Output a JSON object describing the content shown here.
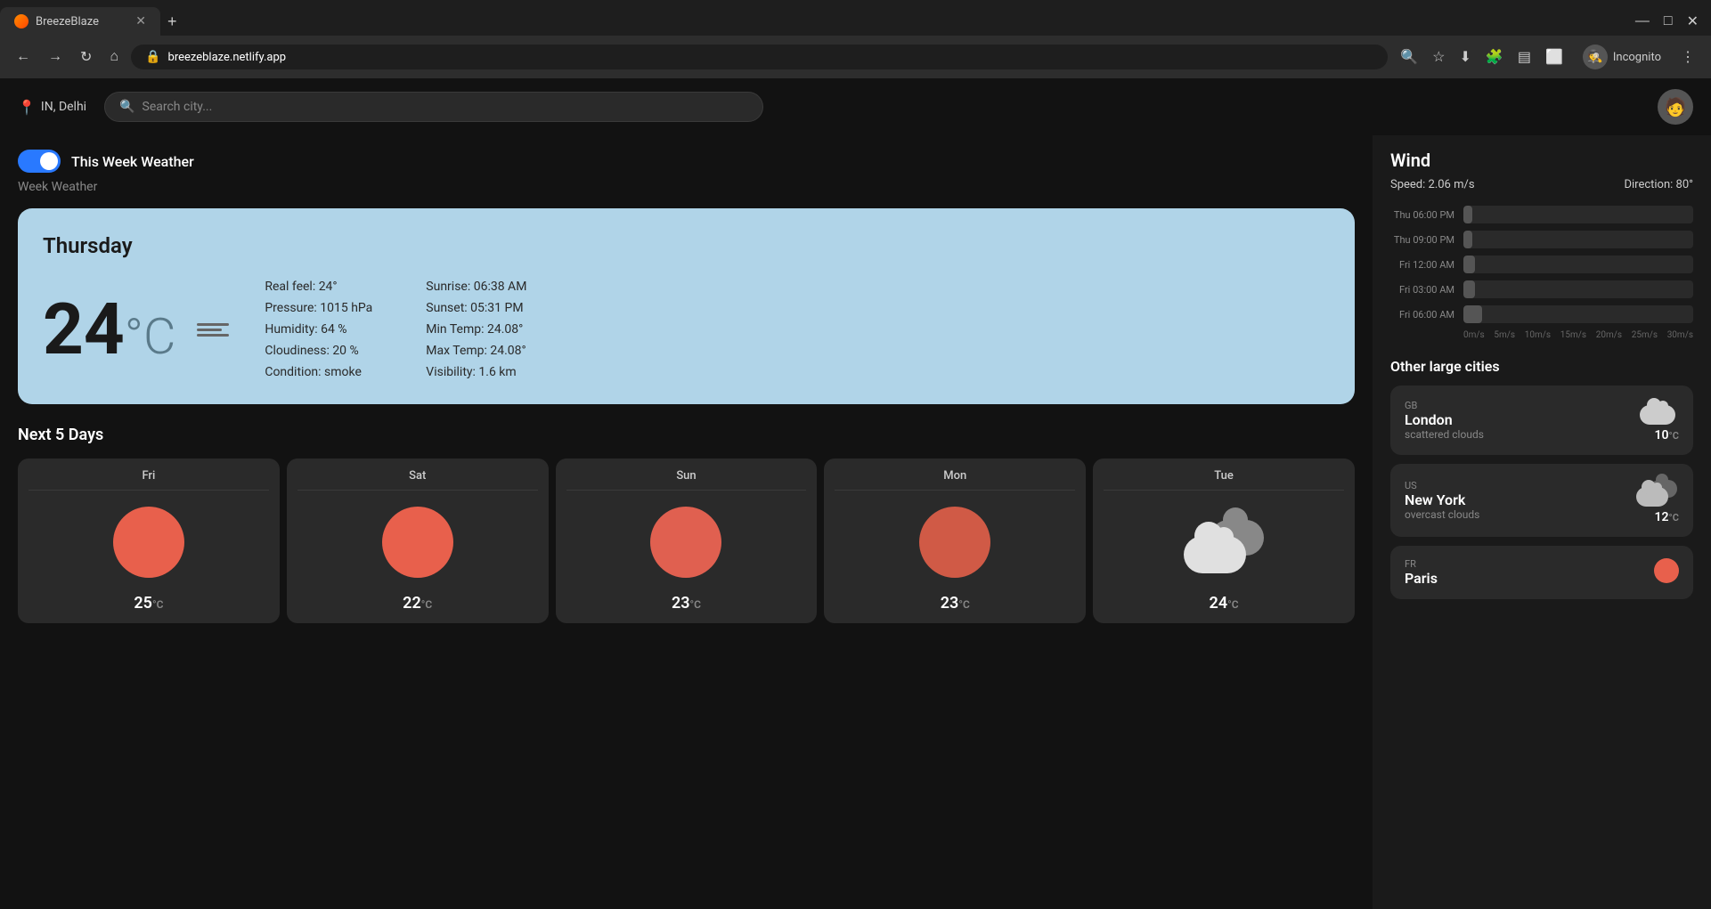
{
  "browser": {
    "tab_title": "BreezeBlaze",
    "url": "breezeblaze.netlify.app",
    "new_tab_label": "+",
    "incognito_label": "Incognito"
  },
  "header": {
    "location": "IN, Delhi",
    "search_placeholder": "Search city...",
    "location_icon": "📍"
  },
  "toggle": {
    "label": "This Week Weather",
    "is_on": true
  },
  "week_weather": {
    "subtitle": "Week Weather"
  },
  "current_day": {
    "day": "Thursday",
    "temp": "24",
    "temp_unit": "°C",
    "real_feel": "Real feel: 24°",
    "pressure": "Pressure: 1015 hPa",
    "humidity": "Humidity: 64 %",
    "cloudiness": "Cloudiness: 20 %",
    "condition": "Condition: smoke",
    "sunrise": "Sunrise: 06:38 AM",
    "sunset": "Sunset: 05:31 PM",
    "min_temp": "Min Temp: 24.08°",
    "max_temp": "Max Temp: 24.08°",
    "visibility": "Visibility: 1.6 km"
  },
  "next5days": {
    "title": "Next 5 Days",
    "days": [
      {
        "name": "Fri",
        "temp": "25",
        "type": "sun"
      },
      {
        "name": "Sat",
        "temp": "22",
        "type": "sun"
      },
      {
        "name": "Sun",
        "temp": "23",
        "type": "sun"
      },
      {
        "name": "Mon",
        "temp": "23",
        "type": "sun"
      },
      {
        "name": "Tue",
        "temp": "24",
        "type": "cloud"
      }
    ]
  },
  "wind": {
    "title": "Wind",
    "speed": "Speed: 2.06 m/s",
    "direction": "Direction: 80°",
    "bars": [
      {
        "label": "Thu 06:00 PM",
        "pct": 4
      },
      {
        "label": "Thu 09:00 PM",
        "pct": 4
      },
      {
        "label": "Fri 12:00 AM",
        "pct": 5
      },
      {
        "label": "Fri 03:00 AM",
        "pct": 5
      },
      {
        "label": "Fri 06:00 AM",
        "pct": 8
      }
    ],
    "scale": [
      "0m/s",
      "5m/s",
      "10m/s",
      "15m/s",
      "20m/s",
      "25m/s",
      "30m/s"
    ]
  },
  "other_cities": {
    "title": "Other large cities",
    "cities": [
      {
        "country": "GB",
        "name": "London",
        "condition": "scattered clouds",
        "temp": "10",
        "icon_type": "cloud"
      },
      {
        "country": "US",
        "name": "New York",
        "condition": "overcast clouds",
        "temp": "12",
        "icon_type": "overcast"
      },
      {
        "country": "FR",
        "name": "Paris",
        "condition": "",
        "temp": "",
        "icon_type": "sun"
      }
    ]
  }
}
